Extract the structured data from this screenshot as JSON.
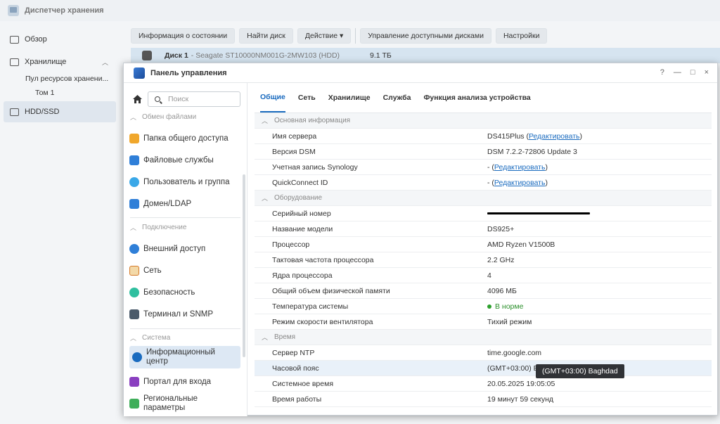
{
  "bg": {
    "app_title": "Диспетчер хранения",
    "sidebar": {
      "overview": "Обзор",
      "storage": "Хранилище",
      "pool": "Пул ресурсов хранени...",
      "volume": "Том 1",
      "hdd": "HDD/SSD"
    },
    "toolbar": {
      "status_info": "Информация о состоянии",
      "find_disk": "Найти диск",
      "action": "Действие ▾",
      "manage_disks": "Управление доступными дисками",
      "settings": "Настройки"
    },
    "disk": {
      "name": "Диск 1",
      "model": " - Seagate ST10000NM001G-2MW103 (HDD)",
      "size": "9.1 ТБ"
    }
  },
  "window": {
    "title": "Панель управления",
    "controls": [
      "?",
      "—",
      "□",
      "×"
    ]
  },
  "cp": {
    "search_placeholder": "Поиск",
    "sections": {
      "file_sharing": "Обмен файлами",
      "connectivity": "Подключение",
      "system": "Система"
    },
    "nav": {
      "shared_folder": "Папка общего доступа",
      "file_services": "Файловые службы",
      "user_group": "Пользователь и группа",
      "domain": "Домен/LDAP",
      "external_access": "Внешний доступ",
      "network": "Сеть",
      "security": "Безопасность",
      "terminal": "Терминал и SNMP",
      "info_center_1": "Информационный",
      "info_center_2": "центр",
      "login_portal": "Портал для входа",
      "regional_1": "Региональные",
      "regional_2": "параметры"
    },
    "tabs": [
      "Общие",
      "Сеть",
      "Хранилище",
      "Служба",
      "Функция анализа устройства"
    ],
    "groups": {
      "basic": "Основная информация",
      "hardware": "Оборудование",
      "time": "Время"
    },
    "rows": {
      "server_name_k": "Имя сервера",
      "server_name_v": "DS415Plus (",
      "edit": "Редактировать",
      "close_paren": ")",
      "dsm_k": "Версия DSM",
      "dsm_v": "DSM 7.2.2-72806 Update 3",
      "synology_k": "Учетная запись Synology",
      "dash_paren": "- (",
      "quickconnect_k": "QuickConnect ID",
      "serial_k": "Серийный номер",
      "model_k": "Название модели",
      "model_v": "DS925+",
      "cpu_k": "Процессор",
      "cpu_v": "AMD Ryzen V1500B",
      "clock_k": "Тактовая частота процессора",
      "clock_v": "2.2 GHz",
      "cores_k": "Ядра процессора",
      "cores_v": "4",
      "mem_k": "Общий объем физической памяти",
      "mem_v": "4096 МБ",
      "temp_k": "Температура системы",
      "temp_v": "В норме",
      "fan_k": "Режим скорости вентилятора",
      "fan_v": "Тихий режим",
      "ntp_k": "Сервер NTP",
      "ntp_v": "time.google.com",
      "tz_k": "Часовой пояс",
      "tz_v": "(GMT+03:00) Baghdad",
      "systime_k": "Системное время",
      "systime_v": "20.05.2025 19:05:05",
      "uptime_k": "Время работы",
      "uptime_v": "19 минут 59 секунд"
    },
    "tooltip": "(GMT+03:00) Baghdad"
  },
  "colors": {
    "accent": "#1a6bbf",
    "ok": "#2ca02c"
  }
}
